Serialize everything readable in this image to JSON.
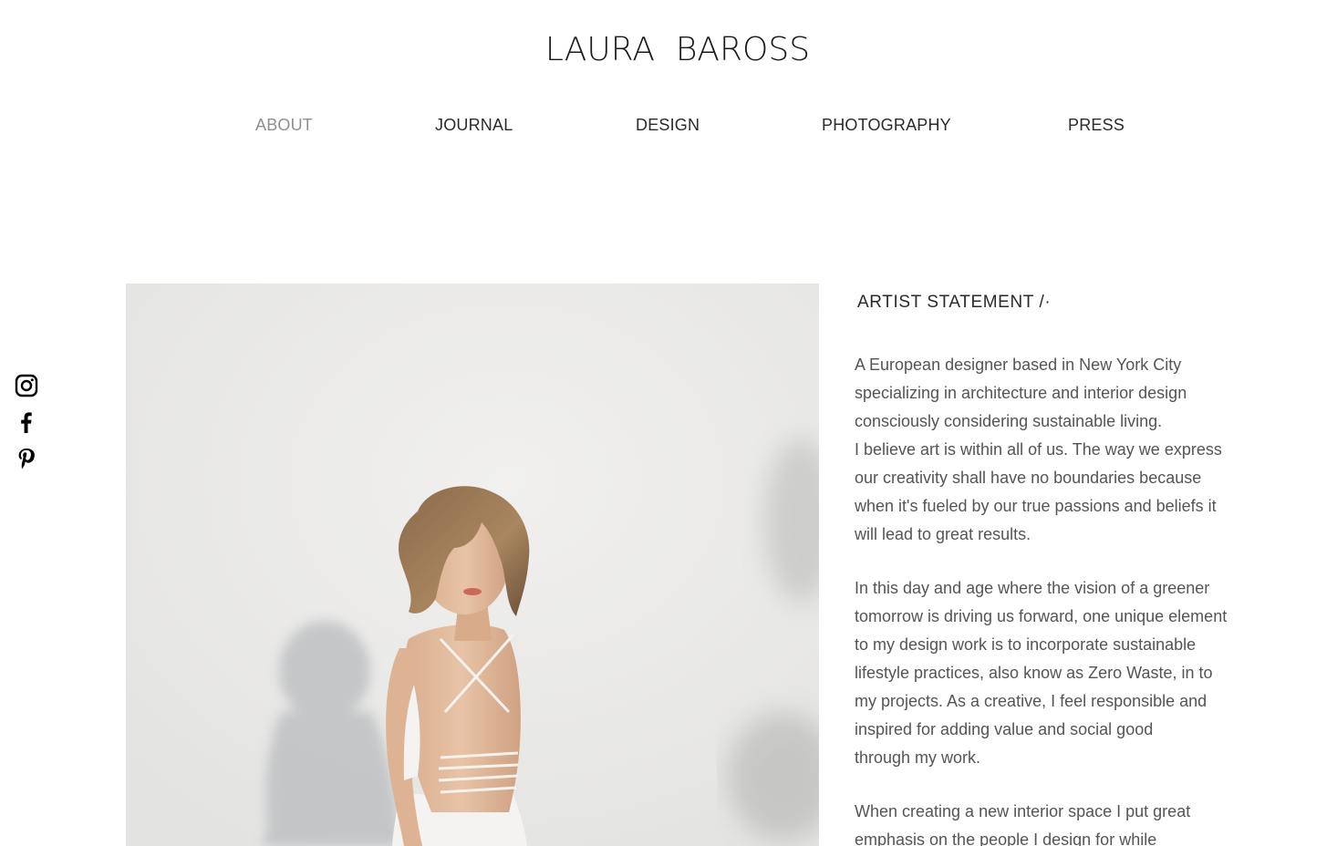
{
  "site": {
    "title": "LAURA  BAROSS"
  },
  "nav": {
    "items": [
      {
        "label": "ABOUT",
        "active": true
      },
      {
        "label": "JOURNAL",
        "active": false
      },
      {
        "label": "DESIGN",
        "active": false
      },
      {
        "label": "PHOTOGRAPHY",
        "active": false
      },
      {
        "label": "PRESS",
        "active": false
      }
    ]
  },
  "social": {
    "icons": [
      "instagram-icon",
      "facebook-icon",
      "pinterest-icon"
    ]
  },
  "photo": {
    "subject": "portrait-photo"
  },
  "statement": {
    "heading": "ARTIST STATEMENT /·",
    "lines": [
      "A European designer based in New York City",
      "specializing in architecture and interior design",
      "consciously considering sustainable living.",
      "I believe art is within all of us. The way we express",
      "our creativity shall have no boundaries because",
      "when it's fueled by our true passions and beliefs it",
      "will lead to great results.",
      "In this day and age where the vision of a greener",
      "tomorrow is driving us forward, one unique element",
      "to my design work is to incorporate sustainable",
      "lifestyle practices, also know as Zero Waste, in to",
      "my projects.  As a creative, I feel responsible and",
      "inspired for adding value and social good",
      "through my work.",
      "When creating a new interior space I put great",
      "emphasis on the people I design for while"
    ]
  },
  "colors": {
    "text": "#333333",
    "nav_active": "#8f8f8f",
    "background": "#ffffff"
  }
}
